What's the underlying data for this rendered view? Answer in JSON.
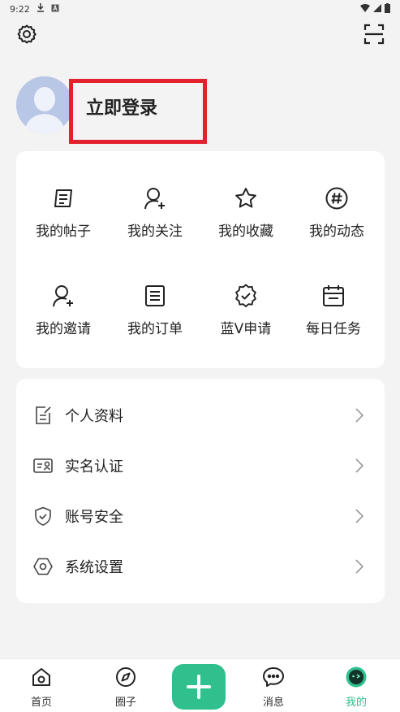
{
  "status_bar": {
    "time": "9:22"
  },
  "header": {
    "login_label": "立即登录"
  },
  "grid": [
    {
      "label": "我的帖子",
      "icon": "post-icon"
    },
    {
      "label": "我的关注",
      "icon": "follow-user-icon"
    },
    {
      "label": "我的收藏",
      "icon": "star-icon"
    },
    {
      "label": "我的动态",
      "icon": "hashtag-icon"
    },
    {
      "label": "我的邀请",
      "icon": "invite-user-icon"
    },
    {
      "label": "我的订单",
      "icon": "order-list-icon"
    },
    {
      "label": "蓝V申请",
      "icon": "verified-badge-icon"
    },
    {
      "label": "每日任务",
      "icon": "calendar-task-icon"
    }
  ],
  "list": [
    {
      "label": "个人资料",
      "icon": "edit-profile-icon"
    },
    {
      "label": "实名认证",
      "icon": "id-card-icon"
    },
    {
      "label": "账号安全",
      "icon": "shield-check-icon"
    },
    {
      "label": "系统设置",
      "icon": "hexagon-settings-icon"
    }
  ],
  "nav": [
    {
      "label": "首页",
      "icon": "home-icon"
    },
    {
      "label": "圈子",
      "icon": "compass-icon"
    },
    {
      "label": "消息",
      "icon": "message-icon"
    },
    {
      "label": "我的",
      "icon": "profile-face-icon",
      "active": true
    }
  ],
  "colors": {
    "accent": "#2fc08d",
    "annotation": "#e3212e"
  }
}
